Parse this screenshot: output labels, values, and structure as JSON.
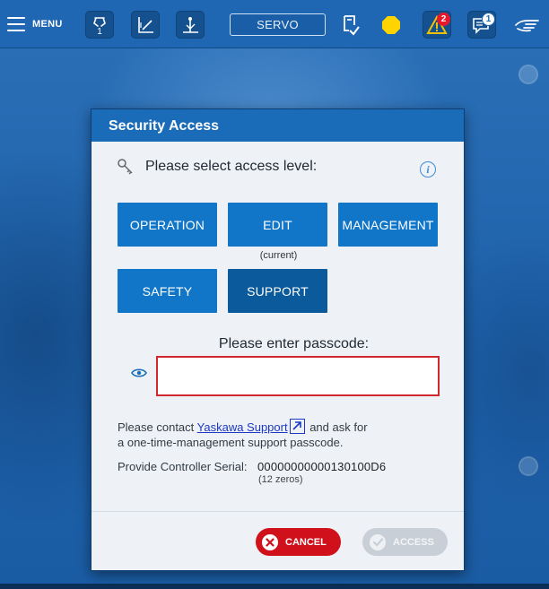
{
  "topbar": {
    "menu_label": "MENU",
    "tool_badge": "1",
    "servo_label": "SERVO",
    "status_color": "#ffd400",
    "alarm_count": "2",
    "message_count": "1"
  },
  "dialog": {
    "title": "Security Access",
    "prompt": "Please select access level:",
    "levels": [
      {
        "label": "OPERATION"
      },
      {
        "label": "EDIT"
      },
      {
        "label": "MANAGEMENT"
      },
      {
        "label": "SAFETY"
      },
      {
        "label": "SUPPORT",
        "selected": true
      }
    ],
    "current_note": "(current)",
    "passcode_label": "Please enter passcode:",
    "passcode_value": "",
    "contact_prefix": "Please contact ",
    "contact_link": "Yaskawa Support",
    "contact_suffix_1": " and ask for",
    "contact_suffix_2": "a one-time-management support passcode.",
    "serial_label": "Provide Controller Serial:",
    "serial_value": "00000000000130100D6",
    "serial_note": "(12 zeros)",
    "cancel_label": "CANCEL",
    "access_label": "ACCESS"
  },
  "colors": {
    "accent": "#1176c8",
    "selected": "#0a5a9c",
    "cancel": "#d0111c",
    "disabled": "#c9cfd6",
    "input_error_border": "#d0282e"
  }
}
